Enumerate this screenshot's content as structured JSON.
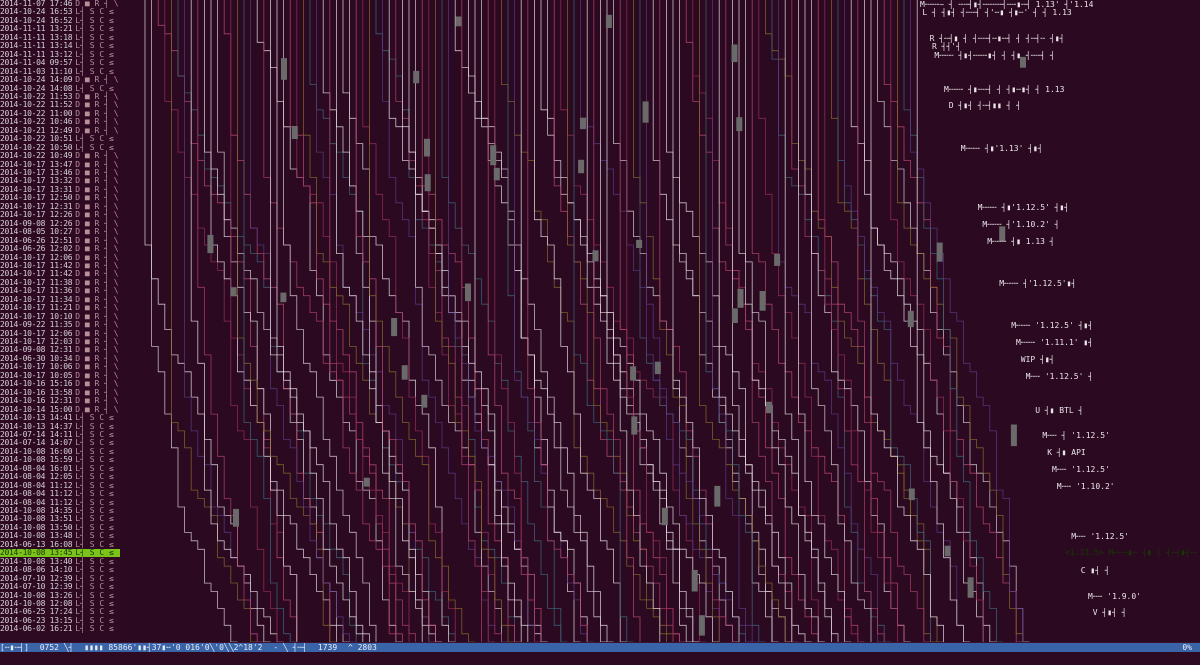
{
  "theme": {
    "background": "#2d0a22",
    "selected": "#7cc41a",
    "status": "#3a64a8"
  },
  "commits": [
    {
      "ts": "2014-11-07 17:46",
      "flags": "D ■ R ┤ \\"
    },
    {
      "ts": "2014-10-24 16:53",
      "flags": "L┤ S C ≤"
    },
    {
      "ts": "2014-10-24 16:52",
      "flags": "L┤ S C ≤"
    },
    {
      "ts": "2014-11-11 13:21",
      "flags": "L┤ S C ≤"
    },
    {
      "ts": "2014-11-11 13:18",
      "flags": "L┤ S C ≤"
    },
    {
      "ts": "2014-11-11 13:14",
      "flags": "L┤ S C ≤"
    },
    {
      "ts": "2014-11-11 13:12",
      "flags": "L┤ S C ≤"
    },
    {
      "ts": "2014-11-04 09:57",
      "flags": "L┤ S C ≤"
    },
    {
      "ts": "2014-11-03 11:10",
      "flags": "L┤ S C ≤"
    },
    {
      "ts": "2014-10-24 14:09",
      "flags": "D ■ R ┤ \\"
    },
    {
      "ts": "2014-10-24 14:08",
      "flags": "L┤ S C ≤"
    },
    {
      "ts": "2014-10-22 11:53",
      "flags": "D ■ R ┤ \\"
    },
    {
      "ts": "2014-10-22 11:52",
      "flags": "D ■ R ┤ \\"
    },
    {
      "ts": "2014-10-22 11:00",
      "flags": "D ■ R ┤ \\"
    },
    {
      "ts": "2014-10-22 10:46",
      "flags": "D ■ R ┤ \\"
    },
    {
      "ts": "2014-10-21 12:49",
      "flags": "D ■ R ┤ \\"
    },
    {
      "ts": "2014-10-22 10:51",
      "flags": "L┤ S C ≤"
    },
    {
      "ts": "2014-10-22 10:50",
      "flags": "L┤ S C ≤"
    },
    {
      "ts": "2014-10-22 10:49",
      "flags": "D ■ R ┤ \\"
    },
    {
      "ts": "2014-10-17 13:47",
      "flags": "D ■ R ┤ \\"
    },
    {
      "ts": "2014-10-17 13:46",
      "flags": "D ■ R ┤ \\"
    },
    {
      "ts": "2014-10-17 13:32",
      "flags": "D ■ R ┤ \\"
    },
    {
      "ts": "2014-10-17 13:31",
      "flags": "D ■ R ┤ \\"
    },
    {
      "ts": "2014-10-17 12:50",
      "flags": "D ■ R ┤ \\"
    },
    {
      "ts": "2014-10-17 12:31",
      "flags": "D ■ R ┤ \\"
    },
    {
      "ts": "2014-10-17 12:26",
      "flags": "D ■ R ┤ \\"
    },
    {
      "ts": "2014-09-08 12:26",
      "flags": "D ■ R ┤ \\"
    },
    {
      "ts": "2014-08-05 10:27",
      "flags": "D ■ R ┤ \\"
    },
    {
      "ts": "2014-06-26 12:51",
      "flags": "D ■ R ┤ \\"
    },
    {
      "ts": "2014-06-26 12:02",
      "flags": "D ■ R ┤ \\"
    },
    {
      "ts": "2014-10-17 12:06",
      "flags": "D ■ R ┤ \\"
    },
    {
      "ts": "2014-10-17 11:42",
      "flags": "D ■ R ┤ \\"
    },
    {
      "ts": "2014-10-17 11:42",
      "flags": "D ■ R ┤ \\"
    },
    {
      "ts": "2014-10-17 11:38",
      "flags": "D ■ R ┤ \\"
    },
    {
      "ts": "2014-10-17 11:36",
      "flags": "D ■ R ┤ \\"
    },
    {
      "ts": "2014-10-17 11:34",
      "flags": "D ■ R ┤ \\"
    },
    {
      "ts": "2014-10-17 11:21",
      "flags": "D ■ R ┤ \\"
    },
    {
      "ts": "2014-10-17 10:10",
      "flags": "D ■ R ┤ \\"
    },
    {
      "ts": "2014-09-22 11:35",
      "flags": "D ■ R ┤ \\"
    },
    {
      "ts": "2014-10-17 12:06",
      "flags": "D ■ R ┤ \\"
    },
    {
      "ts": "2014-10-17 12:03",
      "flags": "D ■ R ┤ \\"
    },
    {
      "ts": "2014-09-08 12:31",
      "flags": "D ■ R ┤ \\"
    },
    {
      "ts": "2014-06-30 10:34",
      "flags": "D ■ R ┤ \\"
    },
    {
      "ts": "2014-10-17 10:06",
      "flags": "D ■ R ┤ \\"
    },
    {
      "ts": "2014-10-17 10:05",
      "flags": "D ■ R ┤ \\"
    },
    {
      "ts": "2014-10-16 15:16",
      "flags": "D ■ R ┤ \\"
    },
    {
      "ts": "2014-10-16 13:58",
      "flags": "D ■ R ┤ \\"
    },
    {
      "ts": "2014-10-16 12:31",
      "flags": "D ■ R ┤ \\"
    },
    {
      "ts": "2014-10-14 15:00",
      "flags": "D ■ R ┤ \\"
    },
    {
      "ts": "2014-10-13 14:41",
      "flags": "L┤ S C ≤"
    },
    {
      "ts": "2014-10-13 14:37",
      "flags": "L┤ S C ≤"
    },
    {
      "ts": "2014-07-14 14:11",
      "flags": "L┤ S C ≤"
    },
    {
      "ts": "2014-07-14 14:07",
      "flags": "L┤ S C ≤"
    },
    {
      "ts": "2014-10-08 16:00",
      "flags": "L┤ S C ≤"
    },
    {
      "ts": "2014-10-08 15:59",
      "flags": "L┤ S C ≤"
    },
    {
      "ts": "2014-08-04 16:01",
      "flags": "L┤ S C ≤"
    },
    {
      "ts": "2014-08-04 12:05",
      "flags": "L┤ S C ≤"
    },
    {
      "ts": "2014-08-04 11:12",
      "flags": "L┤ S C ≤"
    },
    {
      "ts": "2014-08-04 11:12",
      "flags": "L┤ S C ≤"
    },
    {
      "ts": "2014-08-04 11:12",
      "flags": "L┤ S C ≤"
    },
    {
      "ts": "2014-10-08 14:35",
      "flags": "L┤ S C ≤"
    },
    {
      "ts": "2014-10-08 13:51",
      "flags": "L┤ S C ≤"
    },
    {
      "ts": "2014-10-08 13:50",
      "flags": "L┤ S C ≤"
    },
    {
      "ts": "2014-10-08 13:48",
      "flags": "L┤ S C ≤"
    },
    {
      "ts": "2014-06-13 16:08",
      "flags": "L┤ S C ≤"
    },
    {
      "ts": "2014-10-08 13:45",
      "flags": "L┤ S C ≤",
      "selected": true
    },
    {
      "ts": "2014-10-08 13:40",
      "flags": "L┤ S C ≤"
    },
    {
      "ts": "2014-08-06 14:10",
      "flags": "L┤ S C ≤"
    },
    {
      "ts": "2014-07-10 12:39",
      "flags": "L┤ S C ≤"
    },
    {
      "ts": "2014-07-10 12:39",
      "flags": "L┤ S C ≤"
    },
    {
      "ts": "2014-10-08 13:26",
      "flags": "L┤ S C ≤"
    },
    {
      "ts": "2014-10-08 12:08",
      "flags": "L┤ S C ≤"
    },
    {
      "ts": "2014-06-25 17:24",
      "flags": "L┤ S C ≤"
    },
    {
      "ts": "2014-06-23 13:15",
      "flags": "L┤ S C ≤"
    },
    {
      "ts": "2014-06-02 16:21",
      "flags": "L┤ S C ≤"
    }
  ],
  "graph_labels": [
    {
      "text": "M╌╌╌~ ┤ ╌╌┤▮┤╌╌╌╌┤╌╌▮╌┤ 1.13' ┤'1.14"
    },
    {
      "text": "L ┤ ┤▮┤ ┤╌╌┤ ┤'╌▮ ┤▮╌' ┤ ┤ 1.13"
    },
    {
      "text": "R ┤╌┤▮ ┤ ┤╌╌┤╌▮╌┤ ┤ ┤╌┤╌ ┤▮┤"
    },
    {
      "text": "R ┤┤'┤"
    },
    {
      "text": "M╌╌╌ ┤▮┤╌╌╌▮┤ ┤ ┤▮ ┤╌╌┤ ┤"
    },
    {
      "text": "M╌╌╌ ┤▮╌╌┤ ┤ ┤▮╌▮┤ ┤ 1.13"
    },
    {
      "text": "D ┤▮┤ ┤╌┤▮▮ ┤ ┤"
    },
    {
      "text": "M╌╌╌ ┤▮'1.13' ┤▮┤"
    },
    {
      "text": "M╌╌╌ ┤▮'1.12.5' ┤▮┤"
    },
    {
      "text": "M╌╌╌ ┤'1.10.2' ┤"
    },
    {
      "text": "M╌╌╌ ┤▮ 1.13 ┤"
    },
    {
      "text": "M╌╌╌ ┤'1.12.5'▮┤"
    },
    {
      "text": "M╌╌╌ '1.12.5' ┤▮┤"
    },
    {
      "text": "M╌╌╌ '1.11.1' ▮┤"
    },
    {
      "text": "WIP ┤▮┤"
    },
    {
      "text": "M╌╌ '1.12.5' ┤"
    },
    {
      "text": "U ┤▮ BTL ┤"
    },
    {
      "text": "M╌╌ ┤ '1.12.5'"
    },
    {
      "text": "K ┤▮ API"
    },
    {
      "text": "M╌╌ '1.12.5'"
    },
    {
      "text": "M╌╌ '1.10.2'"
    },
    {
      "text": "M╌╌ '1.12.5'"
    },
    {
      "text": "C ▮┤ ┤"
    },
    {
      "text": "M╌╌ '1.9.0'"
    },
    {
      "text": "V ┤▮┤ ┤"
    }
  ],
  "selected_label": "<1.13.5> M╌╌╌▮╌ ┤▮ ┤ ┤╌┤▮┤╌╌┤ ┤╌ ┤▮┤",
  "status": {
    "segments": [
      "[╌▮╌┤]",
      "0752 ╲┤",
      "▮▮▮▮ 85866'▮▮┤37▮╌'0 016'0╲'0╲╲2^18'2",
      "- ╲ ┤╌┤",
      "1739",
      "^ 2803"
    ],
    "right": "0%"
  }
}
